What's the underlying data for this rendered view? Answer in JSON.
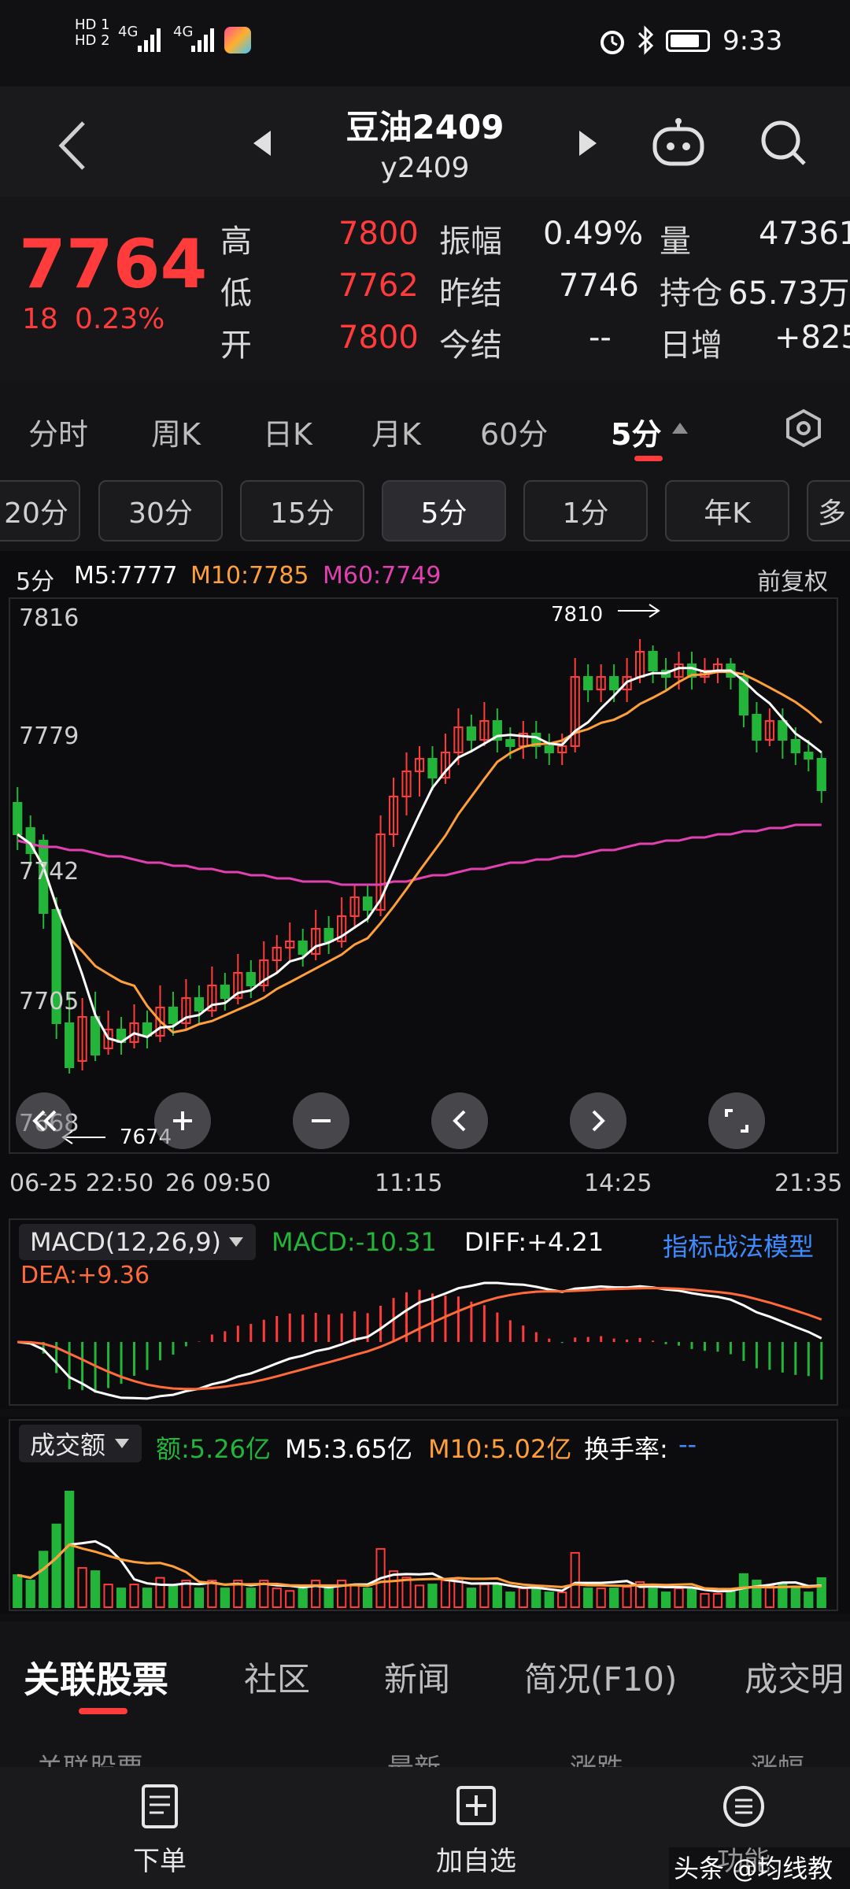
{
  "status": {
    "hd1": "HD 1",
    "hd2": "HD 2",
    "net1": "4G",
    "net2": "4G",
    "time": "9:33"
  },
  "nav": {
    "title": "豆油2409",
    "subtitle": "y2409"
  },
  "quote": {
    "price": "7764",
    "change": "18",
    "change_pct": "0.23%",
    "rows": [
      [
        {
          "l": "高",
          "v": "7800",
          "c": "red"
        },
        {
          "l": "振幅",
          "v": "0.49%",
          "c": "white"
        },
        {
          "l": "量",
          "v": "47361",
          "c": "white"
        }
      ],
      [
        {
          "l": "低",
          "v": "7762",
          "c": "red"
        },
        {
          "l": "昨结",
          "v": "7746",
          "c": "white"
        },
        {
          "l": "持仓",
          "v": "65.73万",
          "c": "white"
        }
      ],
      [
        {
          "l": "开",
          "v": "7800",
          "c": "red"
        },
        {
          "l": "今结",
          "v": "--",
          "c": "white"
        },
        {
          "l": "日增",
          "v": "+825",
          "c": "white"
        }
      ]
    ]
  },
  "periods": {
    "row1": [
      "分时",
      "周K",
      "日K",
      "月K",
      "60分",
      "5分"
    ],
    "row2": [
      "20分",
      "30分",
      "15分",
      "5分",
      "1分",
      "年K",
      "多"
    ],
    "active": "5分"
  },
  "chart": {
    "period_label": "5分",
    "ma5": "M5:7777",
    "ma10": "M10:7785",
    "ma60": "M60:7749",
    "adjust": "前复权",
    "y_labels": [
      "7816",
      "7779",
      "7742",
      "7705",
      "7668"
    ],
    "high_marker": "7810",
    "low_marker": "7674",
    "x_labels": [
      "06-25 22:50",
      "26 09:50",
      "11:15",
      "14:25",
      "21:35"
    ],
    "colors": {
      "up": "#ff3b3b",
      "down": "#22b53a",
      "ma5": "#ffffff",
      "ma10": "#ff9f3a",
      "ma60": "#e23fb0"
    }
  },
  "chart_data": {
    "type": "line",
    "title": "",
    "series_type": "candlestick",
    "ylim": [
      7660,
      7820
    ],
    "candles": [
      {
        "o": 7760,
        "c": 7750,
        "h": 7765,
        "l": 7745
      },
      {
        "o": 7752,
        "c": 7744,
        "h": 7756,
        "l": 7740
      },
      {
        "o": 7748,
        "c": 7725,
        "h": 7750,
        "l": 7720
      },
      {
        "o": 7726,
        "c": 7690,
        "h": 7730,
        "l": 7685
      },
      {
        "o": 7690,
        "c": 7676,
        "h": 7700,
        "l": 7674
      },
      {
        "o": 7678,
        "c": 7692,
        "h": 7698,
        "l": 7675
      },
      {
        "o": 7692,
        "c": 7680,
        "h": 7700,
        "l": 7678
      },
      {
        "o": 7682,
        "c": 7688,
        "h": 7694,
        "l": 7680
      },
      {
        "o": 7688,
        "c": 7684,
        "h": 7692,
        "l": 7680
      },
      {
        "o": 7684,
        "c": 7690,
        "h": 7696,
        "l": 7682
      },
      {
        "o": 7690,
        "c": 7686,
        "h": 7694,
        "l": 7682
      },
      {
        "o": 7686,
        "c": 7695,
        "h": 7702,
        "l": 7684
      },
      {
        "o": 7695,
        "c": 7690,
        "h": 7700,
        "l": 7686
      },
      {
        "o": 7690,
        "c": 7698,
        "h": 7704,
        "l": 7688
      },
      {
        "o": 7698,
        "c": 7694,
        "h": 7702,
        "l": 7690
      },
      {
        "o": 7694,
        "c": 7702,
        "h": 7708,
        "l": 7692
      },
      {
        "o": 7702,
        "c": 7698,
        "h": 7706,
        "l": 7694
      },
      {
        "o": 7698,
        "c": 7706,
        "h": 7712,
        "l": 7696
      },
      {
        "o": 7706,
        "c": 7702,
        "h": 7710,
        "l": 7698
      },
      {
        "o": 7702,
        "c": 7710,
        "h": 7716,
        "l": 7700
      },
      {
        "o": 7710,
        "c": 7714,
        "h": 7718,
        "l": 7706
      },
      {
        "o": 7714,
        "c": 7716,
        "h": 7722,
        "l": 7710
      },
      {
        "o": 7716,
        "c": 7712,
        "h": 7720,
        "l": 7708
      },
      {
        "o": 7712,
        "c": 7720,
        "h": 7726,
        "l": 7710
      },
      {
        "o": 7720,
        "c": 7716,
        "h": 7724,
        "l": 7712
      },
      {
        "o": 7716,
        "c": 7724,
        "h": 7730,
        "l": 7714
      },
      {
        "o": 7724,
        "c": 7730,
        "h": 7734,
        "l": 7720
      },
      {
        "o": 7730,
        "c": 7726,
        "h": 7734,
        "l": 7722
      },
      {
        "o": 7726,
        "c": 7750,
        "h": 7756,
        "l": 7724
      },
      {
        "o": 7750,
        "c": 7762,
        "h": 7768,
        "l": 7746
      },
      {
        "o": 7762,
        "c": 7770,
        "h": 7776,
        "l": 7756
      },
      {
        "o": 7770,
        "c": 7774,
        "h": 7778,
        "l": 7762
      },
      {
        "o": 7774,
        "c": 7768,
        "h": 7778,
        "l": 7764
      },
      {
        "o": 7768,
        "c": 7776,
        "h": 7782,
        "l": 7766
      },
      {
        "o": 7776,
        "c": 7784,
        "h": 7790,
        "l": 7772
      },
      {
        "o": 7784,
        "c": 7780,
        "h": 7788,
        "l": 7776
      },
      {
        "o": 7780,
        "c": 7786,
        "h": 7792,
        "l": 7778
      },
      {
        "o": 7786,
        "c": 7780,
        "h": 7790,
        "l": 7776
      },
      {
        "o": 7780,
        "c": 7778,
        "h": 7784,
        "l": 7774
      },
      {
        "o": 7778,
        "c": 7782,
        "h": 7786,
        "l": 7774
      },
      {
        "o": 7782,
        "c": 7778,
        "h": 7786,
        "l": 7774
      },
      {
        "o": 7778,
        "c": 7776,
        "h": 7782,
        "l": 7772
      },
      {
        "o": 7776,
        "c": 7778,
        "h": 7782,
        "l": 7772
      },
      {
        "o": 7778,
        "c": 7800,
        "h": 7806,
        "l": 7776
      },
      {
        "o": 7800,
        "c": 7796,
        "h": 7804,
        "l": 7792
      },
      {
        "o": 7796,
        "c": 7800,
        "h": 7804,
        "l": 7792
      },
      {
        "o": 7800,
        "c": 7796,
        "h": 7804,
        "l": 7792
      },
      {
        "o": 7796,
        "c": 7800,
        "h": 7806,
        "l": 7792
      },
      {
        "o": 7800,
        "c": 7808,
        "h": 7812,
        "l": 7798
      },
      {
        "o": 7808,
        "c": 7802,
        "h": 7810,
        "l": 7798
      },
      {
        "o": 7802,
        "c": 7800,
        "h": 7806,
        "l": 7796
      },
      {
        "o": 7800,
        "c": 7804,
        "h": 7808,
        "l": 7796
      },
      {
        "o": 7804,
        "c": 7800,
        "h": 7808,
        "l": 7796
      },
      {
        "o": 7800,
        "c": 7802,
        "h": 7806,
        "l": 7798
      },
      {
        "o": 7802,
        "c": 7804,
        "h": 7806,
        "l": 7798
      },
      {
        "o": 7804,
        "c": 7800,
        "h": 7806,
        "l": 7796
      },
      {
        "o": 7800,
        "c": 7788,
        "h": 7802,
        "l": 7784
      },
      {
        "o": 7788,
        "c": 7780,
        "h": 7792,
        "l": 7776
      },
      {
        "o": 7780,
        "c": 7786,
        "h": 7790,
        "l": 7778
      },
      {
        "o": 7786,
        "c": 7780,
        "h": 7790,
        "l": 7774
      },
      {
        "o": 7780,
        "c": 7776,
        "h": 7784,
        "l": 7772
      },
      {
        "o": 7776,
        "c": 7774,
        "h": 7780,
        "l": 7770
      },
      {
        "o": 7774,
        "c": 7764,
        "h": 7776,
        "l": 7760
      }
    ],
    "ma60": [
      7748,
      7747,
      7746,
      7746,
      7745,
      7745,
      7744,
      7743,
      7743,
      7742,
      7741,
      7741,
      7740,
      7740,
      7739,
      7739,
      7738,
      7738,
      7737,
      7737,
      7736,
      7736,
      7735,
      7735,
      7735,
      7734,
      7734,
      7734,
      7734,
      7735,
      7735,
      7736,
      7737,
      7737,
      7738,
      7739,
      7739,
      7740,
      7741,
      7741,
      7742,
      7742,
      7743,
      7743,
      7744,
      7745,
      7745,
      7746,
      7747,
      7747,
      7748,
      7748,
      7749,
      7749,
      7750,
      7750,
      7751,
      7751,
      7752,
      7752,
      7753,
      7753,
      7753
    ],
    "macd_header": {
      "params": "(12,26,9)",
      "macd": "MACD:-10.31",
      "diff": "DIFF:+4.21",
      "dea": "DEA:+9.36"
    },
    "volume_header": {
      "amount": "额:5.26亿",
      "m5": "M5:3.65亿",
      "m10": "M10:5.02亿",
      "turnover": "换手率:",
      "turnover_val": "--"
    }
  },
  "macd_panel": {
    "label": "MACD",
    "params": "(12,26,9)",
    "macd": "MACD:-10.31",
    "diff": "DIFF:+4.21",
    "dea": "DEA:+9.36",
    "model_link": "指标战法模型"
  },
  "volume_panel": {
    "label": "成交额",
    "amount": "额:5.26亿",
    "m5": "M5:3.65亿",
    "m10": "M10:5.02亿",
    "turnover": "换手率:",
    "turnover_val": "--"
  },
  "bottom_tabs": [
    "关联股票",
    "社区",
    "新闻",
    "简况(F10)",
    "成交明"
  ],
  "list_header": [
    "关联股票",
    "最新",
    "涨跌",
    "涨幅"
  ],
  "footer": {
    "order": "下单",
    "add": "加自选",
    "more": "功能",
    "watermark": "头条 @均线教主"
  }
}
